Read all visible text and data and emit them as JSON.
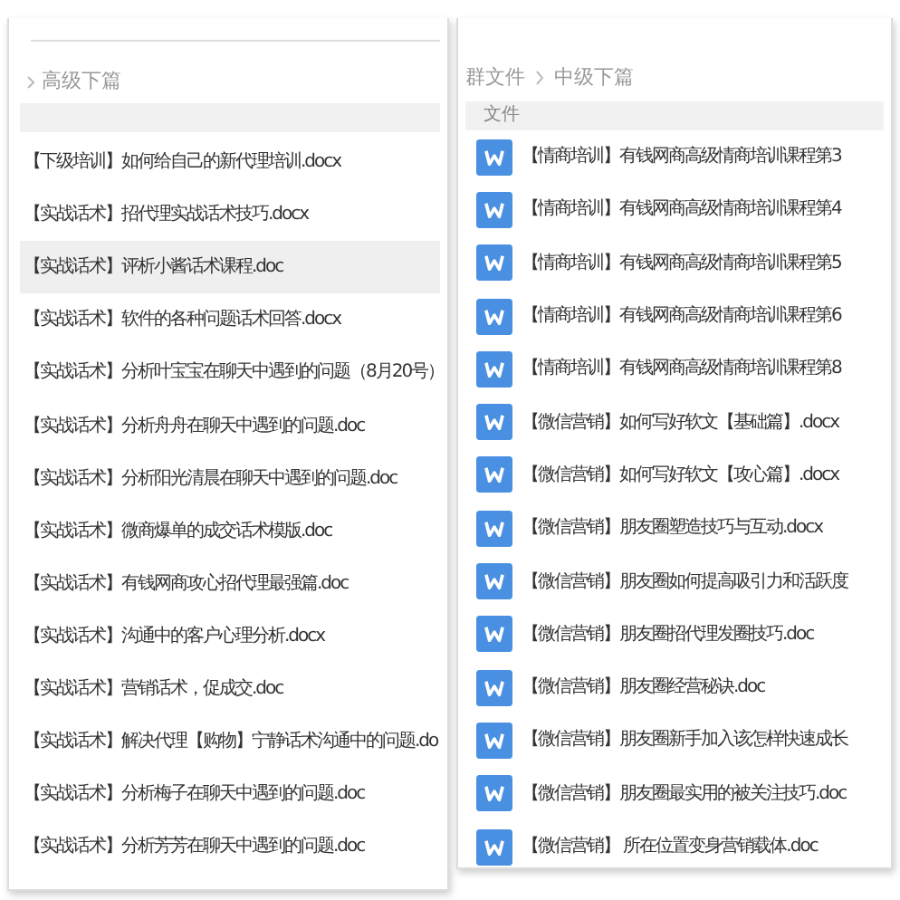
{
  "left_panel": {
    "title": "高级下篇",
    "items": [
      {
        "name": "【下级培训】如何给自己的新代理培训.docx",
        "selected": false
      },
      {
        "name": "【实战话术】招代理实战话术技巧.docx",
        "selected": false
      },
      {
        "name": "【实战话术】评析小酱话术课程.doc",
        "selected": true
      },
      {
        "name": "【实战话术】软件的各种问题话术回答.docx",
        "selected": false
      },
      {
        "name": "【实战话术】分析叶宝宝在聊天中遇到的问题（8月20号）",
        "selected": false
      },
      {
        "name": "【实战话术】分析舟舟在聊天中遇到的问题.doc",
        "selected": false
      },
      {
        "name": "【实战话术】分析阳光清晨在聊天中遇到的问题.doc",
        "selected": false
      },
      {
        "name": "【实战话术】微商爆单的成交话术模版.doc",
        "selected": false
      },
      {
        "name": "【实战话术】有钱网商攻心招代理最强篇.doc",
        "selected": false
      },
      {
        "name": "【实战话术】沟通中的客户心理分析.docx",
        "selected": false
      },
      {
        "name": "【实战话术】营销话术，促成交.doc",
        "selected": false
      },
      {
        "name": "【实战话术】解决代理【购物】宁静话术沟通中的问题.do",
        "selected": false
      },
      {
        "name": "【实战话术】分析梅子在聊天中遇到的问题.doc",
        "selected": false
      },
      {
        "name": "【实战话术】分析芳芳在聊天中遇到的问题.doc",
        "selected": false
      }
    ]
  },
  "right_panel": {
    "breadcrumb": [
      "群文件",
      "中级下篇"
    ],
    "column_header": "文件",
    "files": [
      "【情商培训】有钱网商高级情商培训课程第3",
      "【情商培训】有钱网商高级情商培训课程第4",
      "【情商培训】有钱网商高级情商培训课程第5",
      "【情商培训】有钱网商高级情商培训课程第6",
      "【情商培训】有钱网商高级情商培训课程第8",
      "【微信营销】如何写好软文【基础篇】.docx",
      "【微信营销】如何写好软文【攻心篇】.docx",
      "【微信营销】朋友圈塑造技巧与互动.docx",
      "【微信营销】朋友圈如何提高吸引力和活跃度",
      "【微信营销】朋友圈招代理发圈技巧.doc",
      "【微信营销】朋友圈经营秘诀.doc",
      "【微信营销】朋友圈新手加入该怎样快速成长",
      "【微信营销】朋友圈最实用的被关注技巧.doc",
      "【微信营销】 所在位置变身营销载体.doc"
    ]
  }
}
